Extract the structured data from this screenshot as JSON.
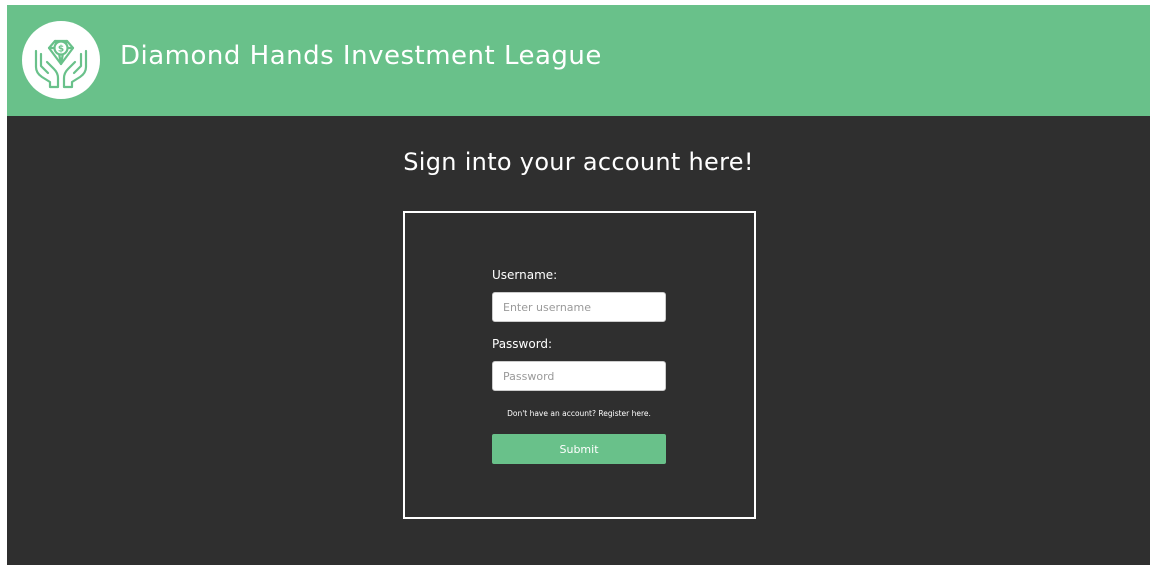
{
  "header": {
    "title": "Diamond Hands Investment League",
    "logo_icon": "diamond-dollar-hands-icon",
    "background_color": "#69c18a"
  },
  "main": {
    "heading": "Sign into your account here!",
    "background_color": "#2f2f2f"
  },
  "login_form": {
    "username_label": "Username:",
    "username_placeholder": "Enter username",
    "username_value": "",
    "password_label": "Password:",
    "password_placeholder": "Password",
    "password_value": "",
    "register_prompt": "Don't have an account?",
    "register_link": "Register here.",
    "submit_label": "Submit",
    "accent_color": "#69c18a"
  }
}
